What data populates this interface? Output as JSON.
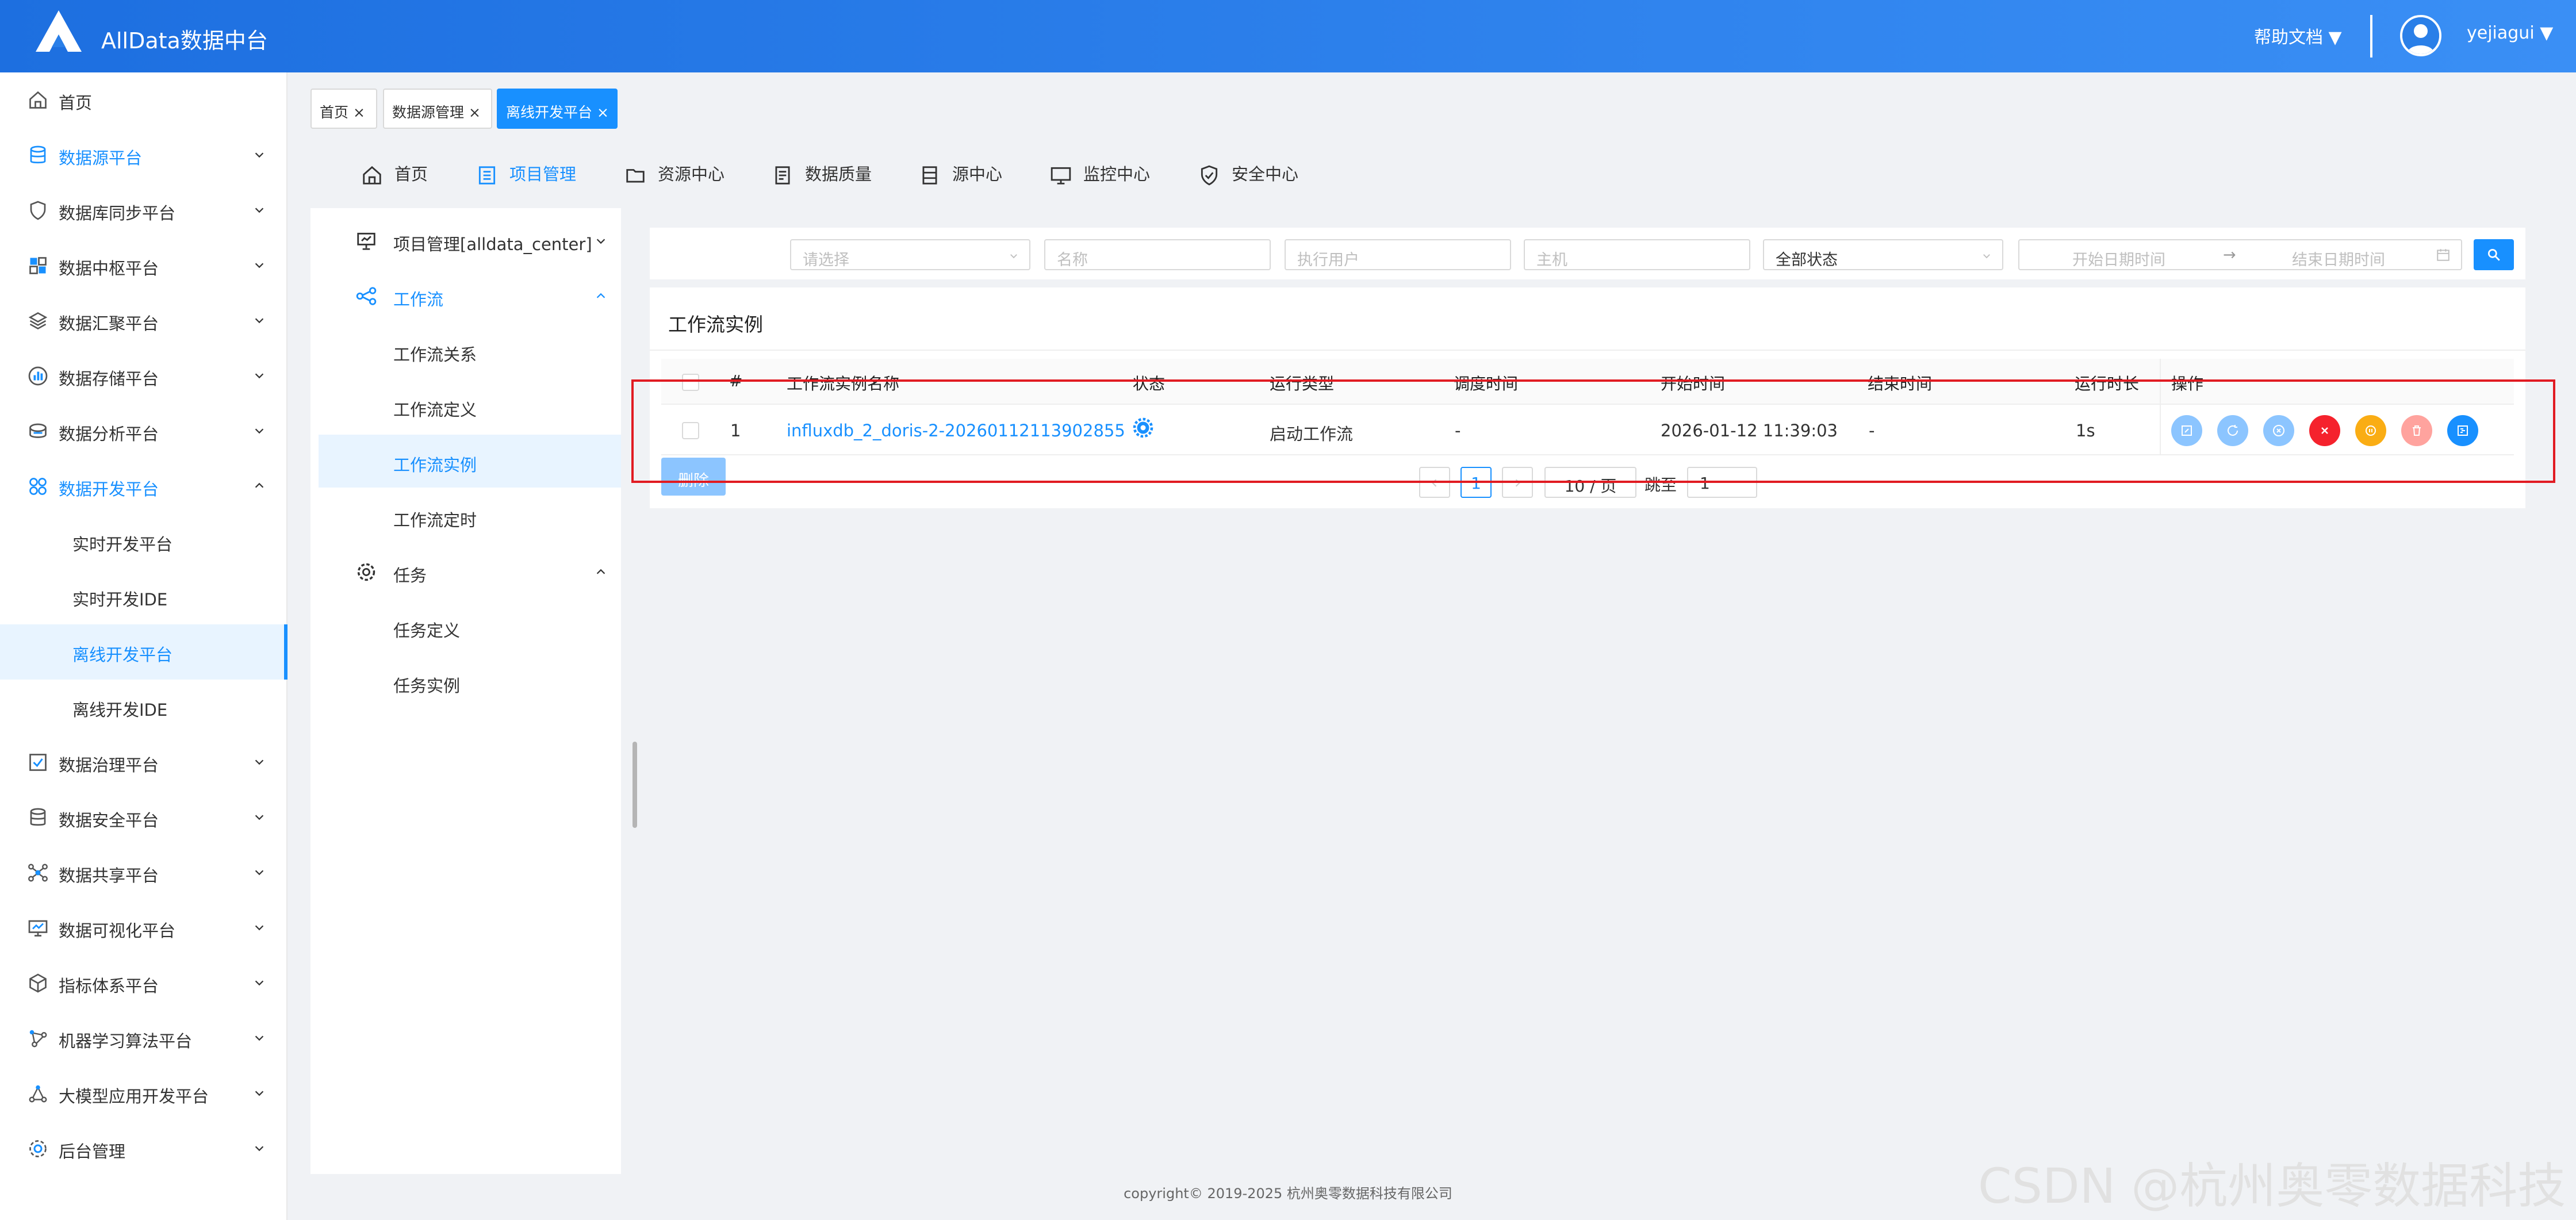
{
  "header": {
    "title": "AllData数据中台",
    "help_label": "帮助文档 ▼",
    "username": "yejiagui ▼"
  },
  "sidebar": {
    "items": [
      {
        "label": "首页"
      },
      {
        "label": "数据源平台"
      },
      {
        "label": "数据库同步平台"
      },
      {
        "label": "数据中枢平台"
      },
      {
        "label": "数据汇聚平台"
      },
      {
        "label": "数据存储平台"
      },
      {
        "label": "数据分析平台"
      },
      {
        "label": "数据开发平台"
      },
      {
        "label": "实时开发平台"
      },
      {
        "label": "实时开发IDE"
      },
      {
        "label": "离线开发平台"
      },
      {
        "label": "离线开发IDE"
      },
      {
        "label": "数据治理平台"
      },
      {
        "label": "数据安全平台"
      },
      {
        "label": "数据共享平台"
      },
      {
        "label": "数据可视化平台"
      },
      {
        "label": "指标体系平台"
      },
      {
        "label": "机器学习算法平台"
      },
      {
        "label": "大模型应用开发平台"
      },
      {
        "label": "后台管理"
      }
    ]
  },
  "tabs": [
    {
      "label": "首页 ×"
    },
    {
      "label": "数据源管理 ×"
    },
    {
      "label": "离线开发平台 ×"
    }
  ],
  "topmenu": [
    {
      "label": "首页"
    },
    {
      "label": "项目管理"
    },
    {
      "label": "资源中心"
    },
    {
      "label": "数据质量"
    },
    {
      "label": "源中心"
    },
    {
      "label": "监控中心"
    },
    {
      "label": "安全中心"
    }
  ],
  "side2": {
    "items": [
      {
        "label": "项目管理[alldata_center]"
      },
      {
        "label": "工作流"
      },
      {
        "label": "工作流关系"
      },
      {
        "label": "工作流定义"
      },
      {
        "label": "工作流实例"
      },
      {
        "label": "工作流定时"
      },
      {
        "label": "任务"
      },
      {
        "label": "任务定义"
      },
      {
        "label": "任务实例"
      }
    ]
  },
  "filters": {
    "project_placeholder": "请选择",
    "name_placeholder": "名称",
    "executor_placeholder": "执行用户",
    "host_placeholder": "主机",
    "status_value": "全部状态",
    "start_date_placeholder": "开始日期时间",
    "arrow": "→",
    "end_date_placeholder": "结束日期时间"
  },
  "table": {
    "title": "工作流实例",
    "columns": [
      "#",
      "工作流实例名称",
      "状态",
      "运行类型",
      "调度时间",
      "开始时间",
      "结束时间",
      "运行时长",
      "操作"
    ],
    "rows": [
      {
        "index": "1",
        "name": "influxdb_2_doris-2-20260112113902855",
        "run_type": "启动工作流",
        "schedule_time": "-",
        "start_time": "2026-01-12 11:39:03",
        "end_time": "-",
        "duration": "1s"
      }
    ],
    "delete_label": "删除"
  },
  "pagination": {
    "current_page": "1",
    "page_size": "10 / 页",
    "jump_label": "跳至",
    "jump_value": "1"
  },
  "footer": {
    "copyright": "copyright© 2019-2025 杭州奥零数据科技有限公司"
  },
  "watermark": "CSDN @杭州奥零数据科技",
  "colors": {
    "primary": "#1890ff",
    "header_start": "#1d6fe0",
    "header_end": "#3a8ff5",
    "highlight_box": "#e11b22"
  }
}
